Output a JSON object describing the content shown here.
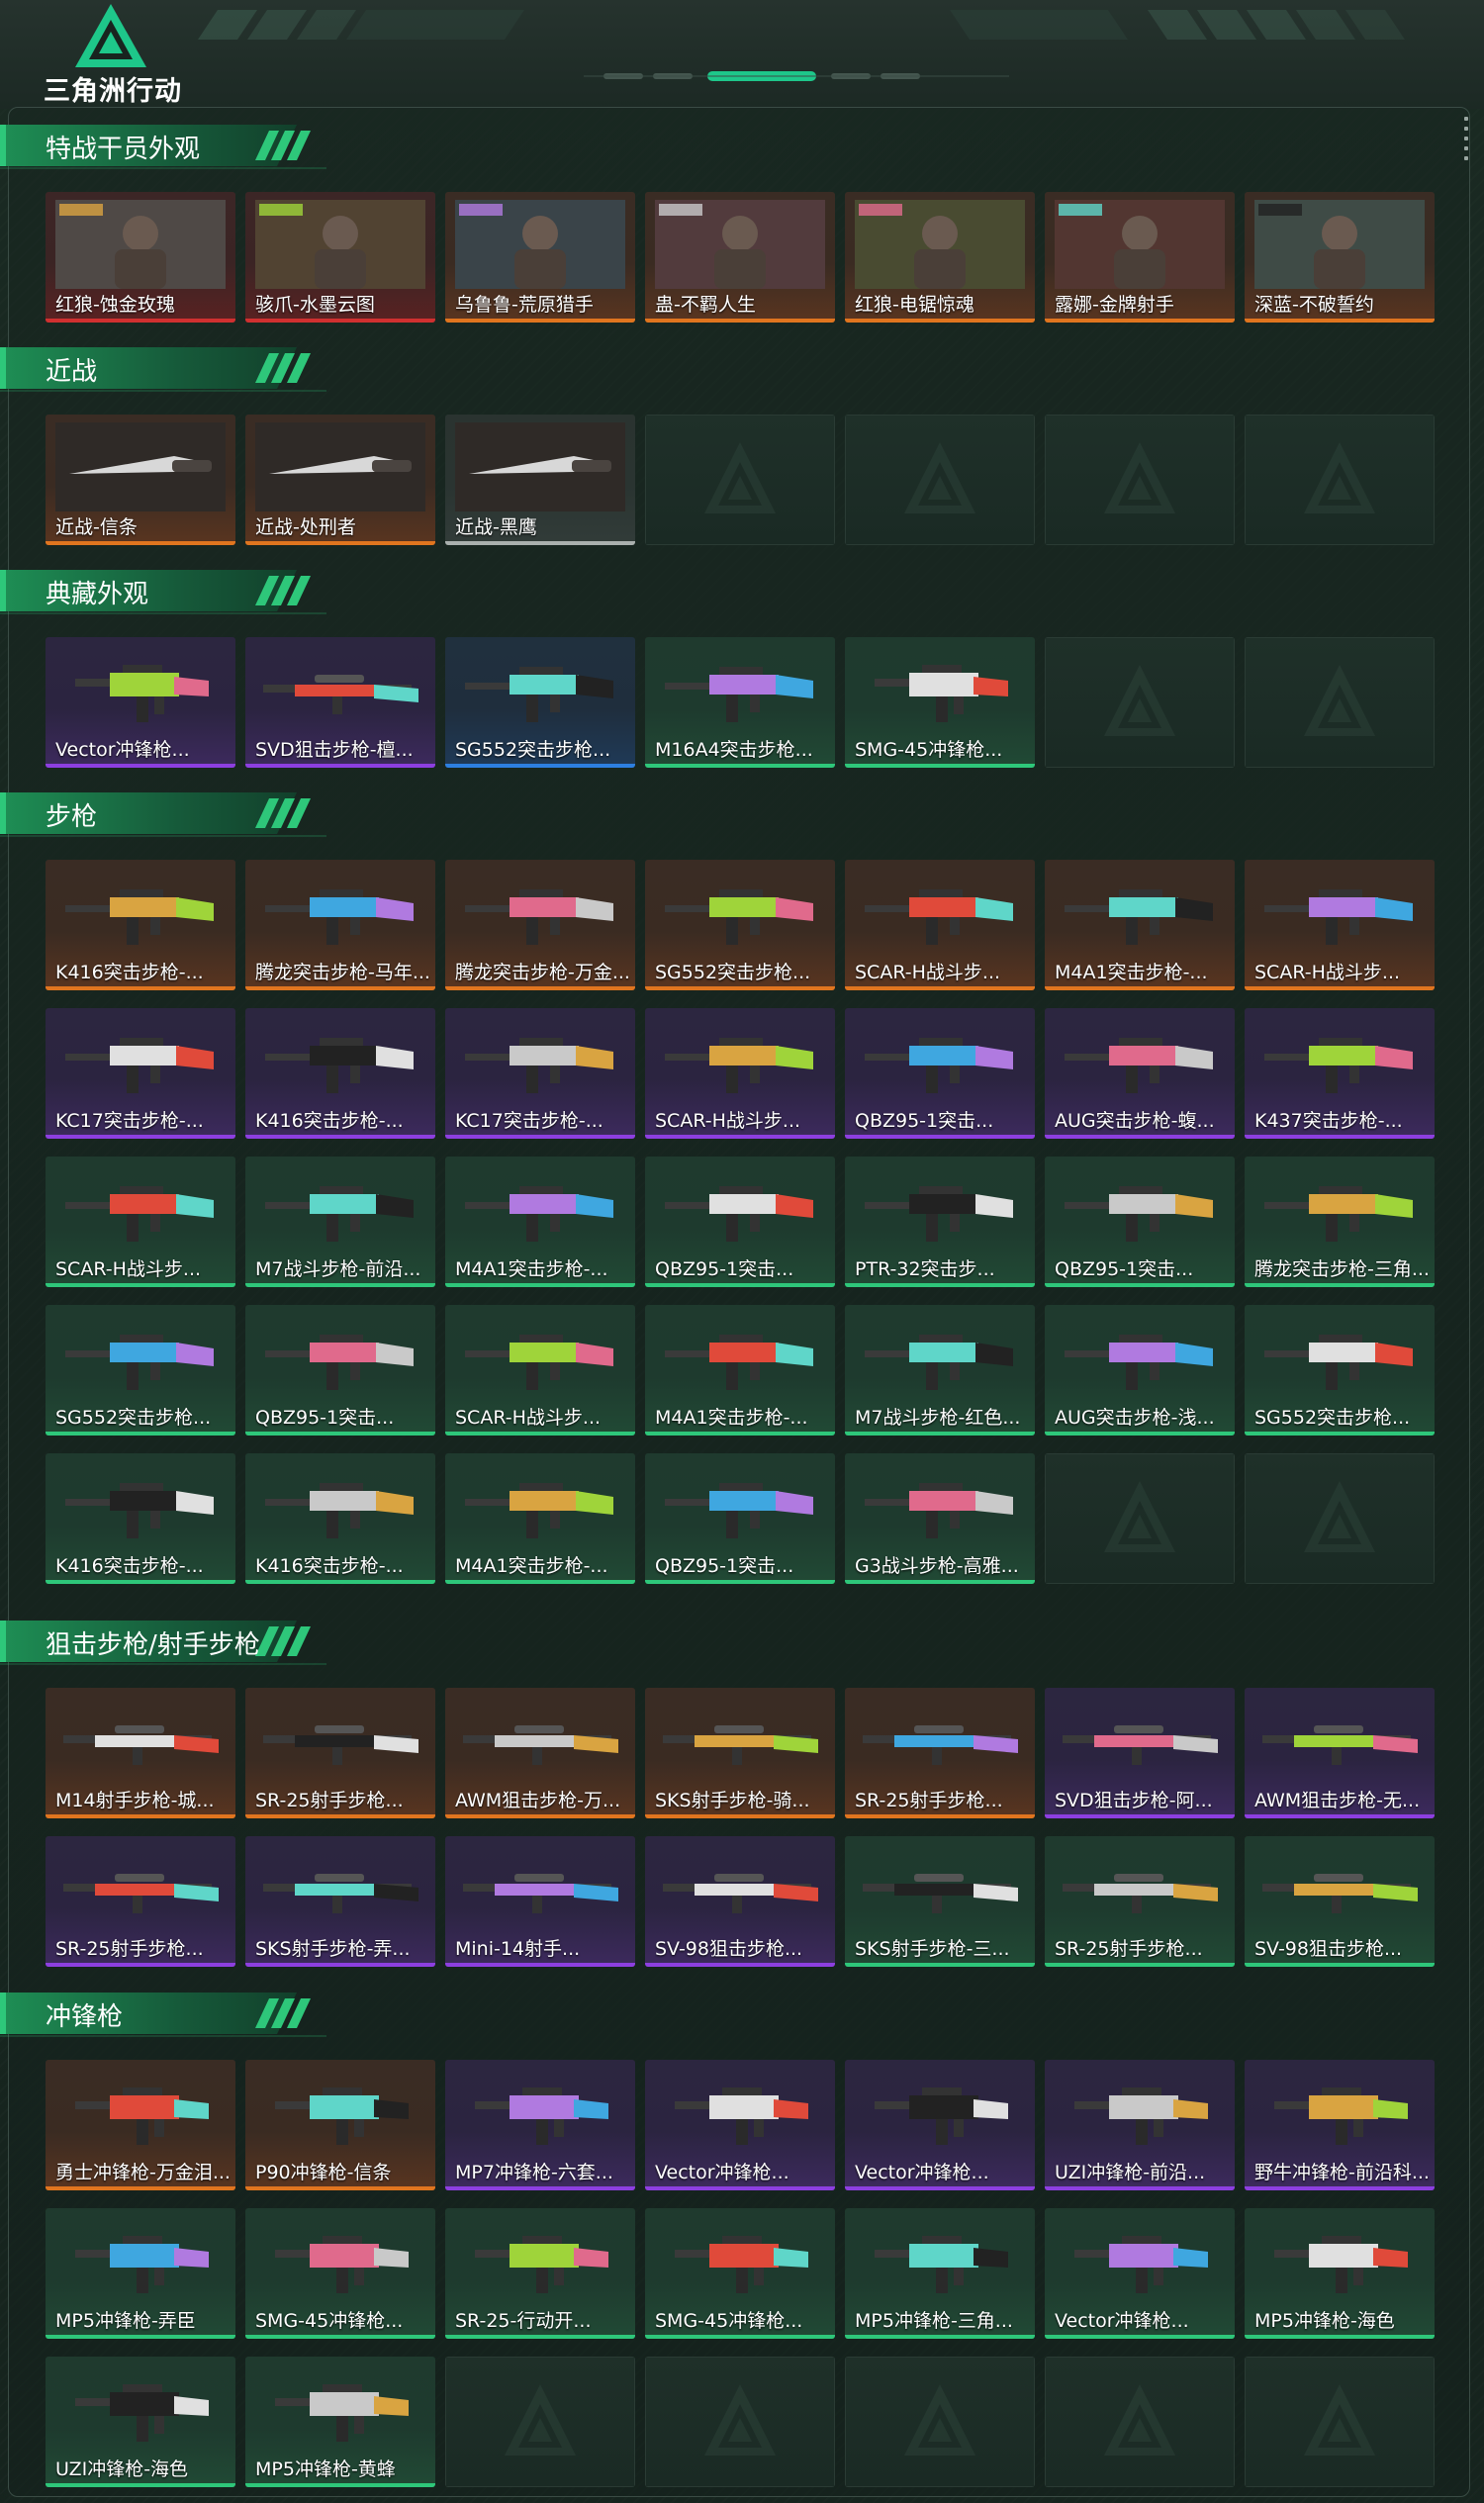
{
  "app": {
    "logo_text": "三角洲行动"
  },
  "colors": {
    "accent": "#2ec77a",
    "orange": "#e0751f",
    "red": "#d03030",
    "purple": "#8d3fe0",
    "blue": "#2d7fe0",
    "grey": "#aab0ae"
  },
  "sections": [
    {
      "title": "特战干员外观",
      "items": [
        {
          "label": "红狼-蚀金玫瑰",
          "rarity": "red",
          "icon": "operator-portrait"
        },
        {
          "label": "骇爪-水墨云图",
          "rarity": "red",
          "icon": "operator-portrait"
        },
        {
          "label": "乌鲁鲁-荒原猎手",
          "rarity": "orange",
          "icon": "operator-portrait"
        },
        {
          "label": "蛊-不羁人生",
          "rarity": "orange",
          "icon": "operator-portrait"
        },
        {
          "label": "红狼-电锯惊魂",
          "rarity": "orange",
          "icon": "operator-portrait"
        },
        {
          "label": "露娜-金牌射手",
          "rarity": "orange",
          "icon": "operator-portrait"
        },
        {
          "label": "深蓝-不破誓约",
          "rarity": "orange",
          "icon": "operator-portrait"
        }
      ]
    },
    {
      "title": "近战",
      "items": [
        {
          "label": "近战-信条",
          "rarity": "orange",
          "icon": "blade"
        },
        {
          "label": "近战-处刑者",
          "rarity": "orange",
          "icon": "blade"
        },
        {
          "label": "近战-黑鹰",
          "rarity": "grey",
          "icon": "blade"
        },
        {
          "label": "",
          "rarity": "empty"
        },
        {
          "label": "",
          "rarity": "empty"
        },
        {
          "label": "",
          "rarity": "empty"
        },
        {
          "label": "",
          "rarity": "empty"
        }
      ]
    },
    {
      "title": "典藏外观",
      "items": [
        {
          "label": "Vector冲锋枪...",
          "rarity": "purple",
          "icon": "smg"
        },
        {
          "label": "SVD狙击步枪-檀...",
          "rarity": "purple",
          "icon": "sniper"
        },
        {
          "label": "SG552突击步枪...",
          "rarity": "blue",
          "icon": "rifle"
        },
        {
          "label": "M16A4突击步枪...",
          "rarity": "green",
          "icon": "rifle"
        },
        {
          "label": "SMG-45冲锋枪...",
          "rarity": "green",
          "icon": "smg"
        },
        {
          "label": "",
          "rarity": "empty"
        },
        {
          "label": "",
          "rarity": "empty"
        }
      ]
    },
    {
      "title": "步枪",
      "items": [
        {
          "label": "K416突击步枪-...",
          "rarity": "orange",
          "icon": "rifle"
        },
        {
          "label": "腾龙突击步枪-马年...",
          "rarity": "orange",
          "icon": "rifle"
        },
        {
          "label": "腾龙突击步枪-万金...",
          "rarity": "orange",
          "icon": "rifle"
        },
        {
          "label": "SG552突击步枪...",
          "rarity": "orange",
          "icon": "rifle"
        },
        {
          "label": "SCAR-H战斗步...",
          "rarity": "orange",
          "icon": "rifle"
        },
        {
          "label": "M4A1突击步枪-...",
          "rarity": "orange",
          "icon": "rifle"
        },
        {
          "label": "SCAR-H战斗步...",
          "rarity": "orange",
          "icon": "rifle"
        },
        {
          "label": "KC17突击步枪-...",
          "rarity": "purple",
          "icon": "rifle"
        },
        {
          "label": "K416突击步枪-...",
          "rarity": "purple",
          "icon": "rifle"
        },
        {
          "label": "KC17突击步枪-...",
          "rarity": "purple",
          "icon": "rifle"
        },
        {
          "label": "SCAR-H战斗步...",
          "rarity": "purple",
          "icon": "rifle"
        },
        {
          "label": "QBZ95-1突击...",
          "rarity": "purple",
          "icon": "rifle"
        },
        {
          "label": "AUG突击步枪-蝮...",
          "rarity": "purple",
          "icon": "rifle"
        },
        {
          "label": "K437突击步枪-...",
          "rarity": "purple",
          "icon": "rifle"
        },
        {
          "label": "SCAR-H战斗步...",
          "rarity": "green",
          "icon": "rifle"
        },
        {
          "label": "M7战斗步枪-前沿...",
          "rarity": "green",
          "icon": "rifle"
        },
        {
          "label": "M4A1突击步枪-...",
          "rarity": "green",
          "icon": "rifle"
        },
        {
          "label": "QBZ95-1突击...",
          "rarity": "green",
          "icon": "rifle"
        },
        {
          "label": "PTR-32突击步...",
          "rarity": "green",
          "icon": "rifle"
        },
        {
          "label": "QBZ95-1突击...",
          "rarity": "green",
          "icon": "rifle"
        },
        {
          "label": "腾龙突击步枪-三角...",
          "rarity": "green",
          "icon": "rifle"
        },
        {
          "label": "SG552突击步枪...",
          "rarity": "green",
          "icon": "rifle"
        },
        {
          "label": "QBZ95-1突击...",
          "rarity": "green",
          "icon": "rifle"
        },
        {
          "label": "SCAR-H战斗步...",
          "rarity": "green",
          "icon": "rifle"
        },
        {
          "label": "M4A1突击步枪-...",
          "rarity": "green",
          "icon": "rifle"
        },
        {
          "label": "M7战斗步枪-红色...",
          "rarity": "green",
          "icon": "rifle"
        },
        {
          "label": "AUG突击步枪-浅...",
          "rarity": "green",
          "icon": "rifle"
        },
        {
          "label": "SG552突击步枪...",
          "rarity": "green",
          "icon": "rifle"
        },
        {
          "label": "K416突击步枪-...",
          "rarity": "green",
          "icon": "rifle"
        },
        {
          "label": "K416突击步枪-...",
          "rarity": "green",
          "icon": "rifle"
        },
        {
          "label": "M4A1突击步枪-...",
          "rarity": "green",
          "icon": "rifle"
        },
        {
          "label": "QBZ95-1突击...",
          "rarity": "green",
          "icon": "rifle"
        },
        {
          "label": "G3战斗步枪-高雅...",
          "rarity": "green",
          "icon": "rifle"
        },
        {
          "label": "",
          "rarity": "empty"
        },
        {
          "label": "",
          "rarity": "empty"
        }
      ]
    },
    {
      "title": "狙击步枪/射手步枪",
      "items": [
        {
          "label": "M14射手步枪-城...",
          "rarity": "orange",
          "icon": "sniper"
        },
        {
          "label": "SR-25射手步枪...",
          "rarity": "orange",
          "icon": "sniper"
        },
        {
          "label": "AWM狙击步枪-万...",
          "rarity": "orange",
          "icon": "sniper"
        },
        {
          "label": "SKS射手步枪-骑...",
          "rarity": "orange",
          "icon": "sniper"
        },
        {
          "label": "SR-25射手步枪...",
          "rarity": "orange",
          "icon": "sniper"
        },
        {
          "label": "SVD狙击步枪-阿...",
          "rarity": "purple",
          "icon": "sniper"
        },
        {
          "label": "AWM狙击步枪-无...",
          "rarity": "purple",
          "icon": "sniper"
        },
        {
          "label": "SR-25射手步枪...",
          "rarity": "purple",
          "icon": "sniper"
        },
        {
          "label": "SKS射手步枪-弄...",
          "rarity": "purple",
          "icon": "sniper"
        },
        {
          "label": "Mini-14射手...",
          "rarity": "purple",
          "icon": "sniper"
        },
        {
          "label": "SV-98狙击步枪...",
          "rarity": "purple",
          "icon": "sniper"
        },
        {
          "label": "SKS射手步枪-三...",
          "rarity": "green",
          "icon": "sniper"
        },
        {
          "label": "SR-25射手步枪...",
          "rarity": "green",
          "icon": "sniper"
        },
        {
          "label": "SV-98狙击步枪...",
          "rarity": "green",
          "icon": "sniper"
        }
      ]
    },
    {
      "title": "冲锋枪",
      "items": [
        {
          "label": "勇士冲锋枪-万金泪...",
          "rarity": "orange",
          "icon": "smg"
        },
        {
          "label": "P90冲锋枪-信条",
          "rarity": "orange",
          "icon": "smg"
        },
        {
          "label": "MP7冲锋枪-六套...",
          "rarity": "purple",
          "icon": "smg"
        },
        {
          "label": "Vector冲锋枪...",
          "rarity": "purple",
          "icon": "smg"
        },
        {
          "label": "Vector冲锋枪...",
          "rarity": "purple",
          "icon": "smg"
        },
        {
          "label": "UZI冲锋枪-前沿...",
          "rarity": "purple",
          "icon": "smg"
        },
        {
          "label": "野牛冲锋枪-前沿科...",
          "rarity": "purple",
          "icon": "smg"
        },
        {
          "label": "MP5冲锋枪-弄臣",
          "rarity": "green",
          "icon": "smg"
        },
        {
          "label": "SMG-45冲锋枪...",
          "rarity": "green",
          "icon": "smg"
        },
        {
          "label": "SR-25-行动开...",
          "rarity": "green",
          "icon": "smg"
        },
        {
          "label": "SMG-45冲锋枪...",
          "rarity": "green",
          "icon": "smg"
        },
        {
          "label": "MP5冲锋枪-三角...",
          "rarity": "green",
          "icon": "smg"
        },
        {
          "label": "Vector冲锋枪...",
          "rarity": "green",
          "icon": "smg"
        },
        {
          "label": "MP5冲锋枪-海色",
          "rarity": "green",
          "icon": "smg"
        },
        {
          "label": "UZI冲锋枪-海色",
          "rarity": "green",
          "icon": "smg"
        },
        {
          "label": "MP5冲锋枪-黄蜂",
          "rarity": "green",
          "icon": "smg"
        },
        {
          "label": "",
          "rarity": "empty"
        },
        {
          "label": "",
          "rarity": "empty"
        },
        {
          "label": "",
          "rarity": "empty"
        },
        {
          "label": "",
          "rarity": "empty"
        },
        {
          "label": "",
          "rarity": "empty"
        }
      ]
    }
  ]
}
